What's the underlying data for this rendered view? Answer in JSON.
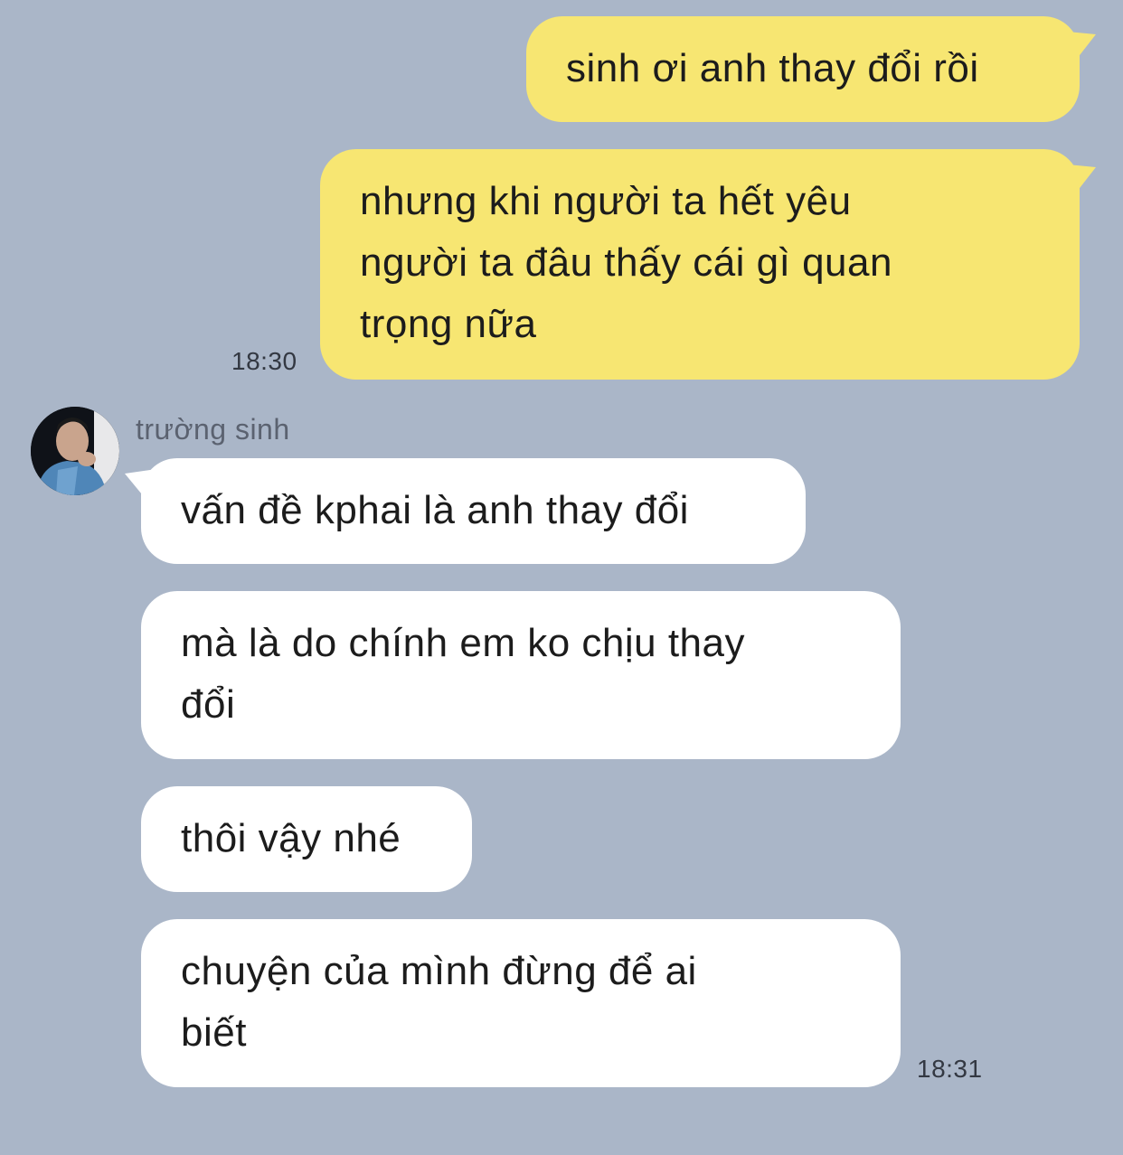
{
  "chat": {
    "outgoing": [
      {
        "lines": [
          "sinh ơi anh thay đổi rồi"
        ]
      },
      {
        "lines": [
          "nhưng khi người ta hết yêu",
          "người ta đâu thấy cái gì quan",
          "trọng nữa"
        ],
        "time": "18:30"
      }
    ],
    "contact": {
      "name": "trường sinh"
    },
    "incoming": [
      {
        "lines": [
          "vấn đề kphai là anh thay đổi"
        ]
      },
      {
        "lines": [
          "mà là do chính em ko chịu thay",
          "đổi"
        ]
      },
      {
        "lines": [
          "thôi vậy nhé"
        ]
      },
      {
        "lines": [
          "chuyện của mình đừng để ai",
          "biết"
        ],
        "time": "18:31"
      }
    ]
  },
  "colors": {
    "background": "#aab6c8",
    "outgoing_bubble": "#f7e672",
    "incoming_bubble": "#ffffff"
  }
}
